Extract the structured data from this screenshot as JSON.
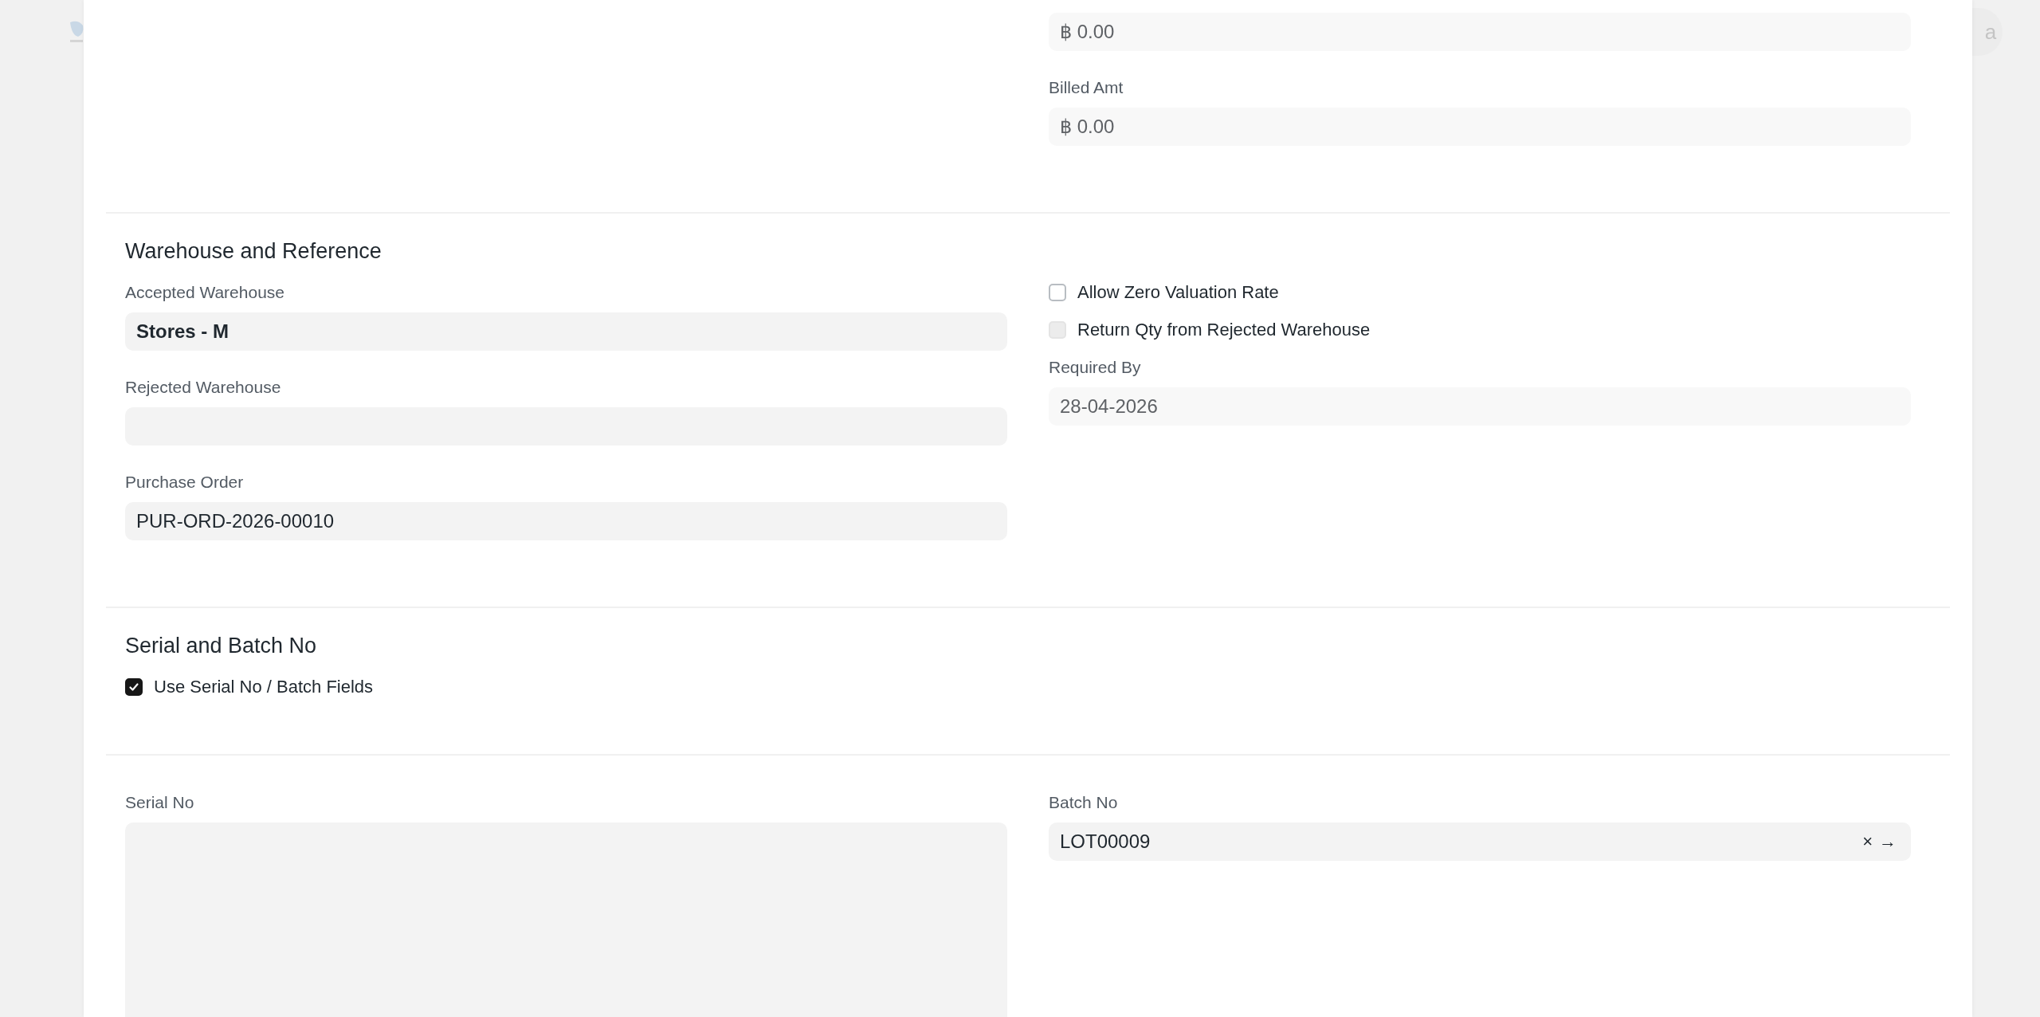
{
  "background": {
    "avatar": "a"
  },
  "sections": [
    {
      "right": [
        {
          "kind": "field",
          "value": "฿ 0.00",
          "readonly": true
        },
        {
          "kind": "field",
          "label": "Billed Amt",
          "value": "฿ 0.00",
          "readonly": true
        }
      ]
    },
    {
      "title": "Warehouse and Reference",
      "left": [
        {
          "kind": "field",
          "label": "Accepted Warehouse",
          "value": "Stores - M",
          "bold": true
        },
        {
          "kind": "field",
          "label": "Rejected Warehouse"
        },
        {
          "kind": "field",
          "label": "Purchase Order",
          "value": "PUR-ORD-2026-00010"
        }
      ],
      "right": [
        {
          "kind": "check",
          "label": "Allow Zero Valuation Rate",
          "checked": false,
          "disabled": false
        },
        {
          "kind": "check",
          "label": "Return Qty from Rejected Warehouse",
          "checked": false,
          "disabled": true
        },
        {
          "kind": "field",
          "label": "Required By",
          "value": "28-04-2026",
          "readonly": true
        }
      ]
    },
    {
      "title": "Serial and Batch No",
      "left": [
        {
          "kind": "check",
          "label": "Use Serial No / Batch Fields",
          "checked": true,
          "disabled": false
        }
      ]
    },
    {
      "left": [
        {
          "kind": "textarea",
          "label": "Serial No"
        }
      ],
      "right": [
        {
          "kind": "link",
          "label": "Batch No",
          "value": "LOT00009",
          "clear": "×",
          "open": "→"
        }
      ]
    }
  ]
}
